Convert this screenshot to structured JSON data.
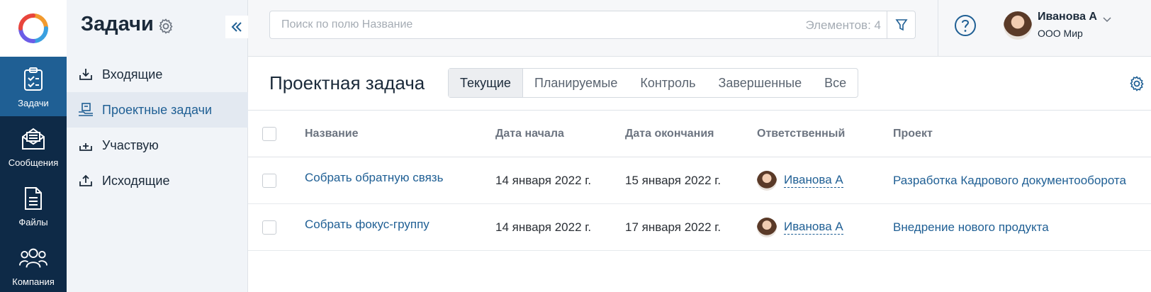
{
  "nav": {
    "items": [
      {
        "label": "Задачи",
        "icon": "tasks-icon"
      },
      {
        "label": "Сообщения",
        "icon": "messages-icon"
      },
      {
        "label": "Файлы",
        "icon": "files-icon"
      },
      {
        "label": "Компания",
        "icon": "company-icon"
      }
    ]
  },
  "sidebar": {
    "title": "Задачи",
    "items": [
      {
        "label": "Входящие",
        "icon": "inbox-icon"
      },
      {
        "label": "Проектные задачи",
        "icon": "project-tasks-icon"
      },
      {
        "label": "Участвую",
        "icon": "participate-icon"
      },
      {
        "label": "Исходящие",
        "icon": "outbox-icon"
      }
    ]
  },
  "search": {
    "placeholder": "Поиск по полю Название",
    "count": "Элементов: 4"
  },
  "user": {
    "name": "Иванова А",
    "org": "ООО Мир"
  },
  "content": {
    "title": "Проектная задача",
    "tabs": [
      "Текущие",
      "Планируемые",
      "Контроль",
      "Завершенные",
      "Все"
    ]
  },
  "table": {
    "columns": [
      "Название",
      "Дата начала",
      "Дата окончания",
      "Ответственный",
      "Проект"
    ],
    "rows": [
      {
        "name": "Собрать обратную связь",
        "start": "14 января 2022 г.",
        "end": "15 января 2022 г.",
        "responsible": "Иванова А",
        "project": "Разработка Кадрового документооборота"
      },
      {
        "name": "Собрать фокус-группу",
        "start": "14 января 2022 г.",
        "end": "17 января 2022 г.",
        "responsible": "Иванова А",
        "project": "Внедрение нового продукта"
      }
    ]
  },
  "colors": {
    "nav_bg": "#0e2a47",
    "nav_active": "#1f5f94",
    "accent": "#1f5f94"
  }
}
